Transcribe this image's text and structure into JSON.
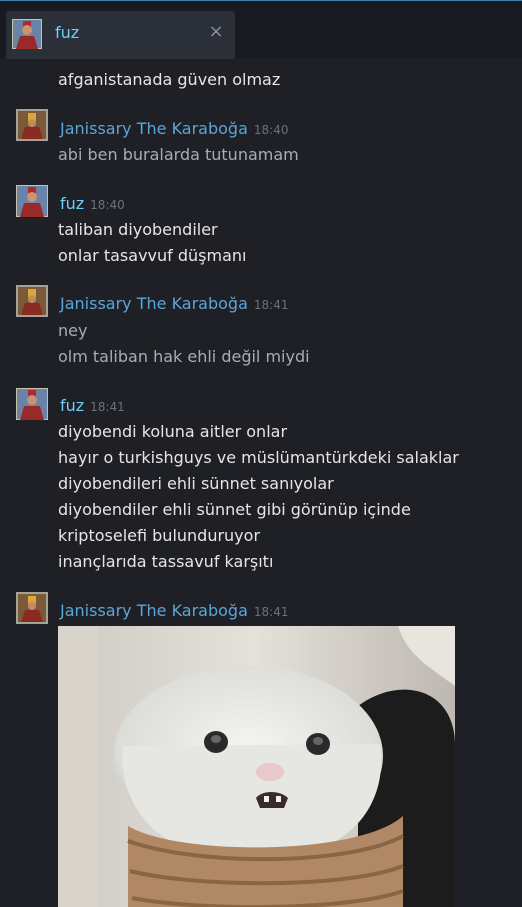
{
  "tab": {
    "name": "fuz",
    "close_icon": "×"
  },
  "messages": [
    {
      "lines": [
        "afganistanada güven olmaz"
      ]
    },
    {
      "author": "Janissary The Karaboğa",
      "time": "18:40",
      "lines": [
        "abi ben buralarda tutunamam"
      ]
    },
    {
      "author": "fuz",
      "time": "18:40",
      "lines": [
        "taliban diyobendiler",
        "onlar tasavvuf düşmanı"
      ]
    },
    {
      "author": "Janissary The Karaboğa",
      "time": "18:41",
      "lines": [
        "ney",
        "olm taliban hak ehli değil miydi"
      ]
    },
    {
      "author": "fuz",
      "time": "18:41",
      "lines": [
        "diyobendi koluna aitler onlar",
        "hayır o turkishguys ve müslümantürkdeki salaklar",
        "diyobendileri ehli sünnet sanıyolar",
        "diyobendiler ehli sünnet gibi görünüp içinde",
        "kriptoselefi bulunduruyor",
        "inançlarıda tassavuf karşıtı"
      ]
    },
    {
      "author": "Janissary The Karaboğa",
      "time": "18:41"
    }
  ],
  "colors": {
    "fuz_name": "#6dcff6",
    "janissary_name": "#5aa6d8",
    "background": "#1e2025"
  }
}
